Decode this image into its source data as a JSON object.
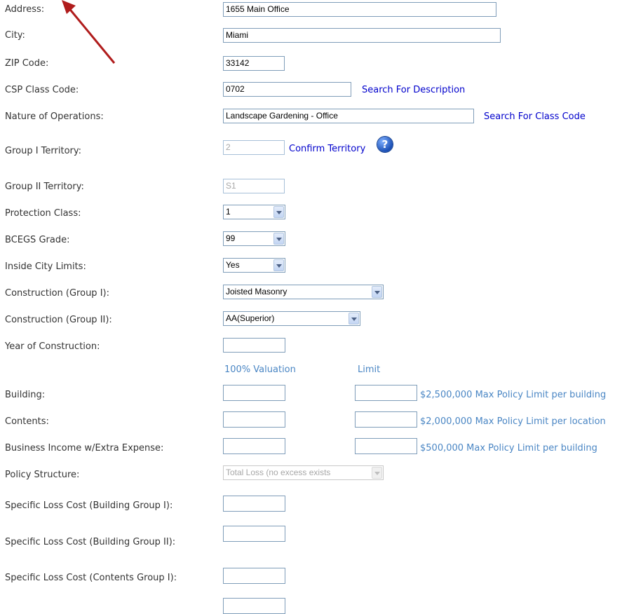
{
  "form": {
    "address": {
      "label": "Address:",
      "value": "1655 Main Office"
    },
    "city": {
      "label": "City:",
      "value": "Miami"
    },
    "zip": {
      "label": "ZIP Code:",
      "value": "33142"
    },
    "csp_class_code": {
      "label": "CSP Class Code:",
      "value": "0702",
      "link": "Search For Description"
    },
    "nature_of_operations": {
      "label": "Nature of Operations:",
      "value": "Landscape Gardening - Office",
      "link": "Search For Class Code"
    },
    "group1_territory": {
      "label": "Group I Territory:",
      "value": "2",
      "link": "Confirm Territory",
      "help_icon": "?"
    },
    "group2_territory": {
      "label": "Group II Territory:",
      "value": "S1"
    },
    "protection_class": {
      "label": "Protection Class:",
      "selected": "1"
    },
    "bcegs_grade": {
      "label": "BCEGS Grade:",
      "selected": "99"
    },
    "inside_city_limits": {
      "label": "Inside City Limits:",
      "selected": "Yes"
    },
    "construction_group1": {
      "label": "Construction (Group I):",
      "selected": "Joisted Masonry"
    },
    "construction_group2": {
      "label": "Construction (Group II):",
      "selected": "AA(Superior)"
    },
    "year_of_construction": {
      "label": "Year of Construction:",
      "value": ""
    },
    "column_headers": {
      "valuation": "100% Valuation",
      "limit": "Limit"
    },
    "building": {
      "label": "Building:",
      "valuation": "",
      "limit": "",
      "note": "$2,500,000 Max Policy Limit per building"
    },
    "contents": {
      "label": "Contents:",
      "valuation": "",
      "limit": "",
      "note": "$2,000,000 Max Policy Limit per location"
    },
    "business_income": {
      "label": "Business Income w/Extra Expense:",
      "valuation": "",
      "limit": "",
      "note": "$500,000 Max Policy Limit per building"
    },
    "policy_structure": {
      "label": "Policy Structure:",
      "selected": "Total Loss (no excess exists"
    },
    "slc_building_g1": {
      "label": "Specific Loss Cost (Building Group I):",
      "value": ""
    },
    "slc_building_g2": {
      "label": "Specific Loss Cost (Building Group II):",
      "value": ""
    },
    "slc_contents_g1": {
      "label": "Specific Loss Cost (Contents Group I):",
      "value": ""
    }
  },
  "annotation": {
    "arrow_color": "#b01c1c"
  },
  "colors": {
    "link": "#0000cc",
    "note": "#4a86c4",
    "input_border": "#7f9db9"
  }
}
